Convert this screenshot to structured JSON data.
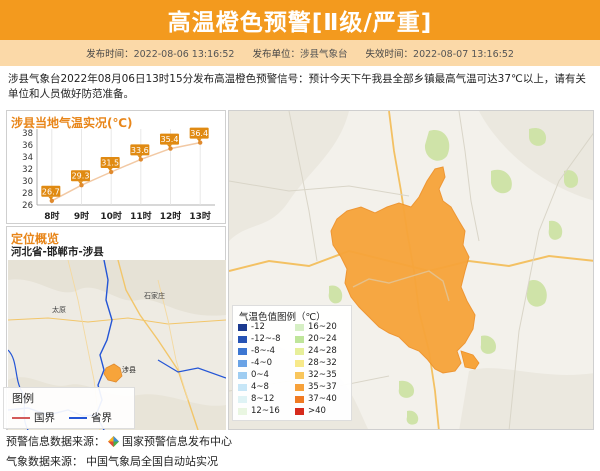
{
  "banner": {
    "title": "高温橙色预警[Ⅱ级/严重]"
  },
  "meta": {
    "publish_time_label": "发布时间：",
    "publish_time": "2022-08-06 13:16:52",
    "publisher_label": "发布单位：",
    "publisher": "涉县气象台",
    "expire_label": "失效时间：",
    "expire_time": "2022-08-07 13:16:52"
  },
  "description": "涉县气象台2022年08月06日13时15分发布高温橙色预警信号：预计今天下午我县全部乡镇最高气温可达37℃以上，请有关单位和人员做好防范准备。",
  "temp_panel": {
    "title": "涉县当地气温实况(℃)"
  },
  "chart_data": {
    "type": "line",
    "categories": [
      "8时",
      "9时",
      "10时",
      "11时",
      "12时",
      "13时"
    ],
    "values": [
      26.7,
      29.3,
      31.5,
      33.6,
      35.4,
      36.4
    ],
    "title": "涉县当地气温实况(℃)",
    "xlabel": "",
    "ylabel": "",
    "ylim": [
      26,
      38
    ],
    "yticks": [
      26,
      28,
      30,
      32,
      34,
      36,
      38
    ],
    "grid": "vertical",
    "line_color": "#f2c9a4",
    "marker_color": "#e08a2e",
    "label_color": "#e08a12"
  },
  "loc_panel": {
    "title": "定位概览",
    "path": "河北省-邯郸市-涉县",
    "labels": {
      "taiyuan": "太原",
      "shijiazhuang": "石家庄",
      "shexian": "涉县"
    }
  },
  "map_legend": {
    "title": "图例",
    "national": "国界",
    "provincial": "省界"
  },
  "color_legend": {
    "title": "气温色值图例（℃）",
    "left": [
      {
        "label": "-12",
        "color": "#1b3a8f"
      },
      {
        "label": "-12~-8",
        "color": "#2653b5"
      },
      {
        "label": "-8~-4",
        "color": "#3c76d2"
      },
      {
        "label": "-4~0",
        "color": "#6aa3e6"
      },
      {
        "label": "0~4",
        "color": "#9fcdf2"
      },
      {
        "label": "4~8",
        "color": "#c7e6f7"
      },
      {
        "label": "8~12",
        "color": "#dff3f5"
      },
      {
        "label": "12~16",
        "color": "#e9f6e1"
      }
    ],
    "right": [
      {
        "label": "16~20",
        "color": "#d6efc4"
      },
      {
        "label": "20~24",
        "color": "#bfe59a"
      },
      {
        "label": "24~28",
        "color": "#e7ef9a"
      },
      {
        "label": "28~32",
        "color": "#f7e98a"
      },
      {
        "label": "32~35",
        "color": "#f9c65c"
      },
      {
        "label": "35~37",
        "color": "#f7a13a"
      },
      {
        "label": "37~40",
        "color": "#f07a22"
      },
      {
        "label": ">40",
        "color": "#d62a1c"
      }
    ]
  },
  "footer": {
    "warning_source_label": "预警信息数据来源：",
    "warning_source": "国家预警信息发布中心",
    "weather_source_label": "气象数据来源：",
    "weather_source": "中国气象局全国自动站实况"
  },
  "colors": {
    "banner": "#f39a1e",
    "meta_bar": "#fbd9a8",
    "warning_fill": "#f7a43a",
    "accent": "#e8861a"
  }
}
